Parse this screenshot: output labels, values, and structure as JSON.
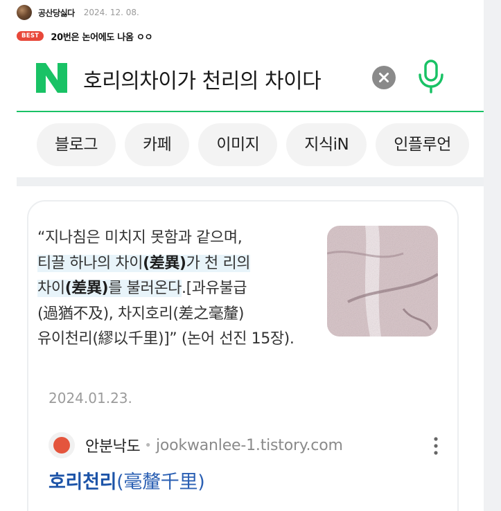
{
  "comment": {
    "author": "공산당싫다",
    "date": "2024. 12. 08.",
    "badge": "BEST",
    "text": "20번은 논어에도 나옴 ㅇㅇ"
  },
  "search": {
    "logo": "N",
    "query": "호리의차이가 천리의 차이다",
    "clear_icon": "close-icon",
    "mic_icon": "mic-icon",
    "brand_color": "#19c265"
  },
  "tabs": [
    "블로그",
    "카페",
    "이미지",
    "지식iN",
    "인플루언"
  ],
  "result": {
    "snippet_open": "“지나침은 미치지 못함과 같으며,",
    "snippet_hl_1a": "티끌 하나의 차이",
    "snippet_hl_1b": "(差異)",
    "snippet_hl_1c": "가 천 리의",
    "snippet_hl_2a": "차이",
    "snippet_hl_2b": "(差異)",
    "snippet_hl_2c": "를 불러온다",
    "snippet_hl_2d": ".",
    "snippet_rest_1": "[과유불급",
    "snippet_rest_2": "(過猶不及), 차지호리(差之毫釐)",
    "snippet_rest_3": "유이천리(繆以千里)]” (논어 선진 15장).",
    "date": "2024.01.23.",
    "site_name": "안분낙도",
    "site_url": "jookwanlee-1.tistory.com",
    "title_main": "호리천리",
    "title_paren": "(毫釐千里)"
  }
}
